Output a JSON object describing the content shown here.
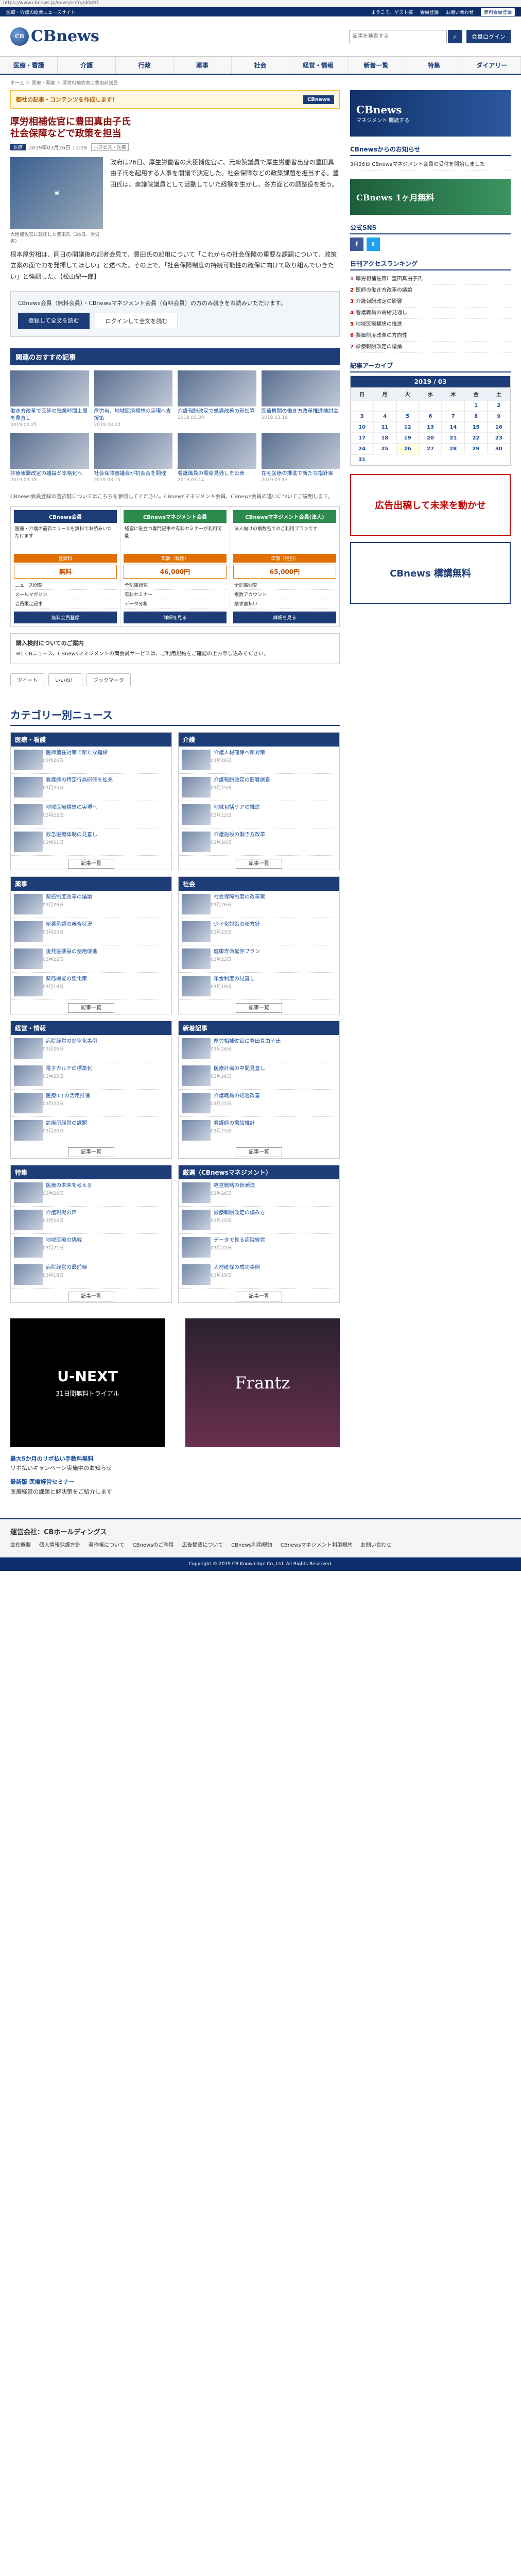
{
  "url": "https://www.cbnews.jp/news/entry/40497",
  "topstrip": {
    "site_desc": "医療・介護の総合ニュースサイト",
    "welcome": "ようこそ、ゲスト様",
    "register": "会員登録",
    "contact": "お問い合わせ",
    "mypage": "無料会員登録"
  },
  "header": {
    "logo_text": "CBnews",
    "logo_mark": "CB",
    "search_placeholder": "記事を検索する",
    "login": "会員ログイン"
  },
  "gnav": [
    "医療・看護",
    "介護",
    "行政",
    "薬事",
    "社会",
    "経営・情報",
    "新着一覧",
    "特集",
    "ダイアリー"
  ],
  "breadcrumb": "ホーム ＞ 医療・看護 ＞ 厚労相補佐官に豊田前議員",
  "banner_top": {
    "text": "御社の記事・コンテンツを作成します！",
    "label": "CBnews"
  },
  "article": {
    "title": "厚労相補佐官に豊田真由子氏\n社会保障などで政策を担当",
    "date": "2019年03月26日 11:09",
    "tag": "ホスピス・医療",
    "chip": "医療",
    "photo_caption": "大臣補佐官に就任した豊田氏（26日、厚労省）",
    "lead": "政府は26日、厚生労働省の大臣補佐官に、元衆院議員で厚生労働省出身の豊田真由子氏を起用する人事を閣議で決定した。社会保障などの政策課題を担当する。豊田氏は、衆議院議員として活動していた経験を生かし、各方面との調整役を担う。",
    "body": "根本厚労相は、同日の閣議後の記者会見で、豊田氏の起用について「これからの社会保障の重要な課題について、政策立案の面で力を発揮してほしい」と述べた。その上で、「社会保障制度の持続可能性の確保に向けて取り組んでいきたい」と強調した。【松山紀一郎】",
    "member_text": "CBnews会員（無料会員）・CBnewsマネジメント会員（有料会員）の方のみ続きをお読みいただけます。",
    "btn_register": "登録して全文を読む",
    "btn_login": "ログインして全文を読む"
  },
  "related": {
    "heading": "関連のおすすめ記事",
    "items": [
      {
        "title": "働き方改革で医師の残業時間上限を見直し",
        "date": "2019.03.25"
      },
      {
        "title": "厚労省、地域医療構想の実現へ支援策",
        "date": "2019.03.22"
      },
      {
        "title": "介護報酬改定で処遇改善の新加算",
        "date": "2019.03.20"
      },
      {
        "title": "医療機関の働き方改革推進検討会",
        "date": "2019.03.19"
      },
      {
        "title": "診療報酬改定の議論が本格化へ",
        "date": "2019.03.18"
      },
      {
        "title": "社会保障審議会が初会合を開催",
        "date": "2019.03.15"
      },
      {
        "title": "看護職員の需給見通しを公表",
        "date": "2019.03.14"
      },
      {
        "title": "在宅医療の推進で新たな指針案",
        "date": "2019.03.13"
      }
    ]
  },
  "plans": {
    "note": "CBnews会員登録の選択肢についてはこちらを参照してください。CBnewsマネジメント会員、CBnews会員の違いについてご説明します。",
    "items": [
      {
        "name": "CBnews会員",
        "sub": "医療・介護の最新ニュースを無料でお読みいただけます",
        "price": "無料",
        "label": "登録料",
        "features": [
          "ニュース閲覧",
          "メールマガジン",
          "会員限定記事"
        ],
        "btn": "無料会員登録"
      },
      {
        "name": "CBnewsマネジメント会員",
        "sub": "経営に役立つ専門記事や有料セミナーが利用可能",
        "price": "46,000円",
        "label": "年額（税別）",
        "features": [
          "全記事閲覧",
          "有料セミナー",
          "データ分析"
        ],
        "btn": "詳細を見る"
      },
      {
        "name": "CBnewsマネジメント会員(法人)",
        "sub": "法人向けの複数名でのご利用プランです",
        "price": "65,000円",
        "label": "年額（税別）",
        "features": [
          "全記事閲覧",
          "複数アカウント",
          "請求書払い"
        ],
        "btn": "詳細を見る"
      }
    ]
  },
  "faq": {
    "heading": "購入検討についてのご案内",
    "text": "※1 CBニュース、CBnewsマネジメントの両会員サービスは、ご利用規約をご確認の上お申し込みください。"
  },
  "share": [
    "ツイート",
    "いいね！",
    "ブックマーク"
  ],
  "categories": {
    "title": "カテゴリー別ニュース",
    "items": [
      {
        "name": "医療・看護",
        "news": [
          {
            "t": "医師偏在対策で新たな指標",
            "d": "03月26日"
          },
          {
            "t": "看護師の特定行為研修を拡充",
            "d": "03月25日"
          },
          {
            "t": "地域医療構想の実現へ",
            "d": "03月22日"
          },
          {
            "t": "救急医療体制の見直し",
            "d": "03月21日"
          }
        ]
      },
      {
        "name": "介護",
        "news": [
          {
            "t": "介護人材確保へ新対策",
            "d": "03月26日"
          },
          {
            "t": "介護報酬改定の影響調査",
            "d": "03月25日"
          },
          {
            "t": "地域包括ケアの推進",
            "d": "03月22日"
          },
          {
            "t": "介護施設の働き方改革",
            "d": "03月20日"
          }
        ]
      },
      {
        "name": "薬事",
        "news": [
          {
            "t": "薬価制度改革の議論",
            "d": "03月26日"
          },
          {
            "t": "新薬承認の審査状況",
            "d": "03月25日"
          },
          {
            "t": "後発医薬品の使用促進",
            "d": "03月22日"
          },
          {
            "t": "薬局機能の強化策",
            "d": "03月19日"
          }
        ]
      },
      {
        "name": "社会",
        "news": [
          {
            "t": "社会保障制度の改革案",
            "d": "03月26日"
          },
          {
            "t": "少子化対策の新方針",
            "d": "03月25日"
          },
          {
            "t": "健康寿命延伸プラン",
            "d": "03月22日"
          },
          {
            "t": "年金制度の見直し",
            "d": "03月18日"
          }
        ]
      },
      {
        "name": "経営・情報",
        "news": [
          {
            "t": "病院経営の効率化事例",
            "d": "03月26日"
          },
          {
            "t": "電子カルテの標準化",
            "d": "03月25日"
          },
          {
            "t": "医療ICTの活用推進",
            "d": "03月22日"
          },
          {
            "t": "診療所経営の課題",
            "d": "03月20日"
          }
        ]
      },
      {
        "name": "新着記事",
        "news": [
          {
            "t": "厚労相補佐官に豊田真由子氏",
            "d": "03月26日"
          },
          {
            "t": "医療計画の中間見直し",
            "d": "03月26日"
          },
          {
            "t": "介護職員の処遇改善",
            "d": "03月25日"
          },
          {
            "t": "看護師の需給推計",
            "d": "03月25日"
          }
        ]
      },
      {
        "name": "特集",
        "news": [
          {
            "t": "医療の未来を考える",
            "d": "03月26日"
          },
          {
            "t": "介護現場の声",
            "d": "03月24日"
          },
          {
            "t": "地域医療の挑戦",
            "d": "03月21日"
          },
          {
            "t": "病院経営の最前線",
            "d": "03月18日"
          }
        ]
      },
      {
        "name": "厳選（CBnewsマネジメント）",
        "news": [
          {
            "t": "経営戦略の新潮流",
            "d": "03月26日"
          },
          {
            "t": "診療報酬改定の読み方",
            "d": "03月25日"
          },
          {
            "t": "データで見る病院経営",
            "d": "03月22日"
          },
          {
            "t": "人材確保の成功事例",
            "d": "03月19日"
          }
        ]
      }
    ],
    "more": "記事一覧"
  },
  "bottom_ads": {
    "ad1": "U-NEXT",
    "ad1_sub": "31日間無料トライアル",
    "ad2": "Frantz"
  },
  "pr": [
    {
      "h": "最大5か月のリボ払い手数料無料",
      "t": "リボ払いキャンペーン実施中のお知らせ"
    },
    {
      "h": "最新版 医療経営セミナー",
      "t": "医療経営の課題と解決策をご紹介します"
    }
  ],
  "sidebar": {
    "ad_main": "CBnews",
    "ad_main_sub": "マネジメント 購読する",
    "notice_h": "CBnewsからのお知らせ",
    "notice": [
      "3月26日 CBnewsマネジメント会員の受付を開始しました"
    ],
    "cb_ad": "CBnews 1ヶ月無料",
    "social_h": "公式SNS",
    "ranking_h": "日刊アクセスランキング",
    "ranking": [
      "厚労相補佐官に豊田真由子氏",
      "医師の働き方改革の議論",
      "介護報酬改定の影響",
      "看護職員の需給見通し",
      "地域医療構想の推進",
      "薬価制度改革の方向性",
      "診療報酬改定の議論"
    ],
    "calendar_h": "記事アーカイブ",
    "calendar_title": "2019 / 03",
    "weekdays": [
      "日",
      "月",
      "火",
      "水",
      "木",
      "金",
      "土"
    ],
    "days": [
      "",
      "",
      "",
      "",
      "",
      "1",
      "2",
      "3",
      "4",
      "5",
      "6",
      "7",
      "8",
      "9",
      "10",
      "11",
      "12",
      "13",
      "14",
      "15",
      "16",
      "17",
      "18",
      "19",
      "20",
      "21",
      "22",
      "23",
      "24",
      "25",
      "26",
      "27",
      "28",
      "29",
      "30",
      "31"
    ],
    "ad2": "広告出稿して未来を動かせ",
    "ad3": "CBnews 構講無料"
  },
  "footer": {
    "title": "運営会社：CBホールディングス",
    "links": [
      "会社概要",
      "個人情報保護方針",
      "著作権について",
      "CBnewsのご利用",
      "広告掲載について",
      "CBnews利用規約",
      "CBnewsマネジメント利用規約",
      "お問い合わせ"
    ],
    "copy": "Copyright © 2019 CB Knowledge Co.,Ltd. All Rights Reserved."
  }
}
